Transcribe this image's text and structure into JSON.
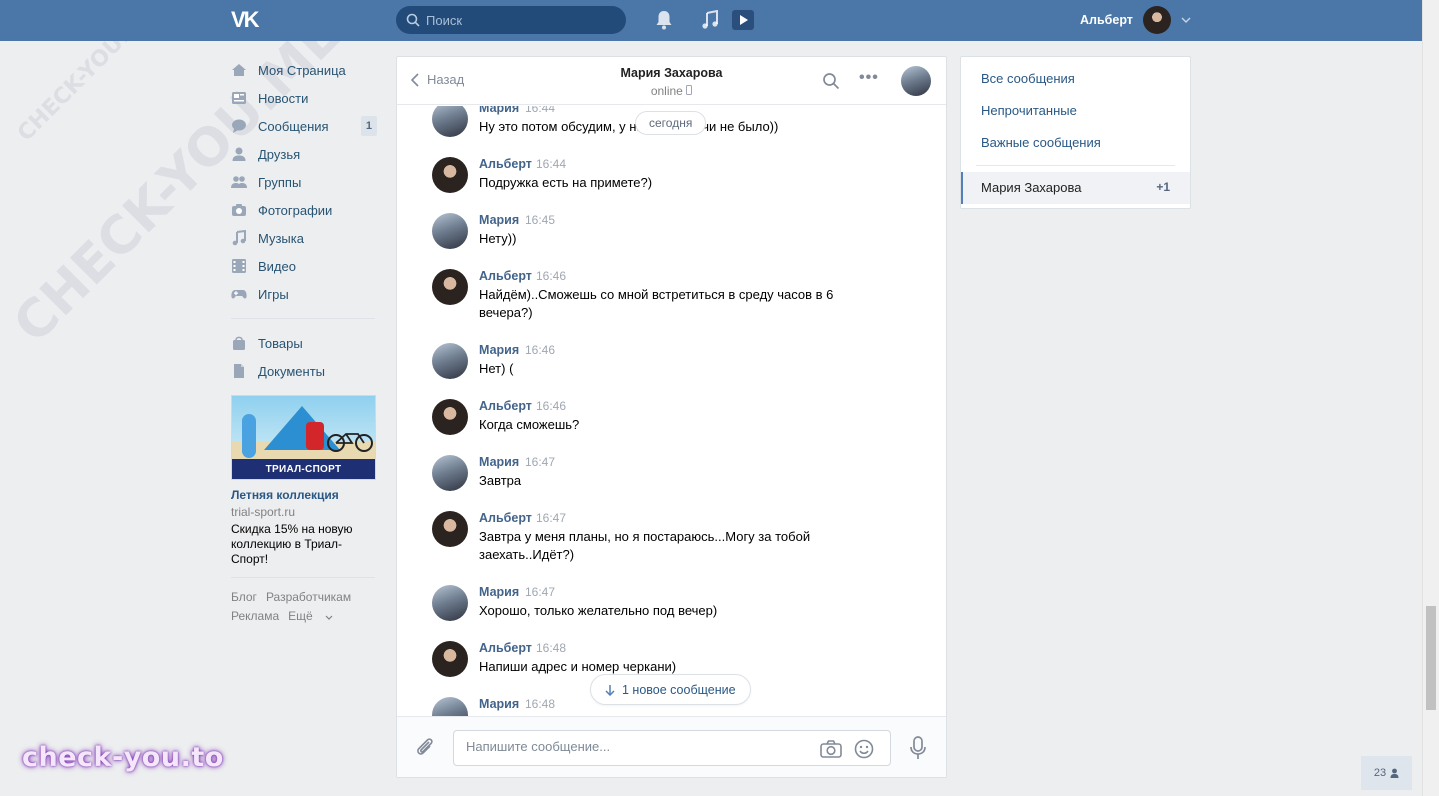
{
  "header": {
    "search_placeholder": "Поиск",
    "user_name": "Альберт",
    "brand_color": "#4a76a8"
  },
  "nav": {
    "items": [
      {
        "label": "Моя Страница",
        "icon": "home-icon"
      },
      {
        "label": "Новости",
        "icon": "news-icon"
      },
      {
        "label": "Сообщения",
        "icon": "messages-icon",
        "badge": "1"
      },
      {
        "label": "Друзья",
        "icon": "friends-icon"
      },
      {
        "label": "Группы",
        "icon": "groups-icon"
      },
      {
        "label": "Фотографии",
        "icon": "camera-icon"
      },
      {
        "label": "Музыка",
        "icon": "music-icon"
      },
      {
        "label": "Видео",
        "icon": "video-icon"
      },
      {
        "label": "Игры",
        "icon": "games-icon"
      }
    ],
    "items2": [
      {
        "label": "Товары",
        "icon": "bag-icon"
      },
      {
        "label": "Документы",
        "icon": "document-icon"
      }
    ]
  },
  "ad": {
    "banner_text": "ТРИАЛ-СПОРТ",
    "title": "Летняя коллекция",
    "domain": "trial-sport.ru",
    "text": "Скидка 15% на новую коллекцию в Триал-Спорт!"
  },
  "footer": {
    "blog": "Блог",
    "dev": "Разработчикам",
    "ads": "Реклама",
    "more": "Ещё"
  },
  "chat": {
    "back_label": "Назад",
    "title": "Мария Захарова",
    "status": "online",
    "date_pill": "сегодня",
    "new_messages": "1 новое сообщение",
    "input_placeholder": "Напишите сообщение...",
    "messages": [
      {
        "author": "Мария",
        "time": "16:44",
        "text": "Ну это потом обсудим, у н... ой встречи не было))"
      },
      {
        "author": "Альберт",
        "time": "16:44",
        "text": "Подружка есть на примете?)"
      },
      {
        "author": "Мария",
        "time": "16:45",
        "text": "Нету))"
      },
      {
        "author": "Альберт",
        "time": "16:46",
        "text": "Найдём)..Сможешь со мной встретиться в среду часов в 6 вечера?)"
      },
      {
        "author": "Мария",
        "time": "16:46",
        "text": "Нет) ("
      },
      {
        "author": "Альберт",
        "time": "16:46",
        "text": "Когда сможешь?"
      },
      {
        "author": "Мария",
        "time": "16:47",
        "text": "Завтра"
      },
      {
        "author": "Альберт",
        "time": "16:47",
        "text": "Завтра у меня планы, но я постараюсь...Могу за тобой заехать..Идёт?)"
      },
      {
        "author": "Мария",
        "time": "16:47",
        "text": "Хорошо, только желательно под вечер)"
      },
      {
        "author": "Альберт",
        "time": "16:48",
        "text": "Напиши адрес и номер черкани)"
      },
      {
        "author": "Мария",
        "time": "16:48",
        "text": ""
      }
    ]
  },
  "right_panel": {
    "all": "Все сообщения",
    "unread": "Непрочитанные",
    "important": "Важные сообщения",
    "active_name": "Мария Захарова",
    "active_count": "+1"
  },
  "watermark": {
    "logo_text": "check-you.to",
    "diagonal_text": "CHECK-YOU.ME"
  },
  "online_count": "23"
}
